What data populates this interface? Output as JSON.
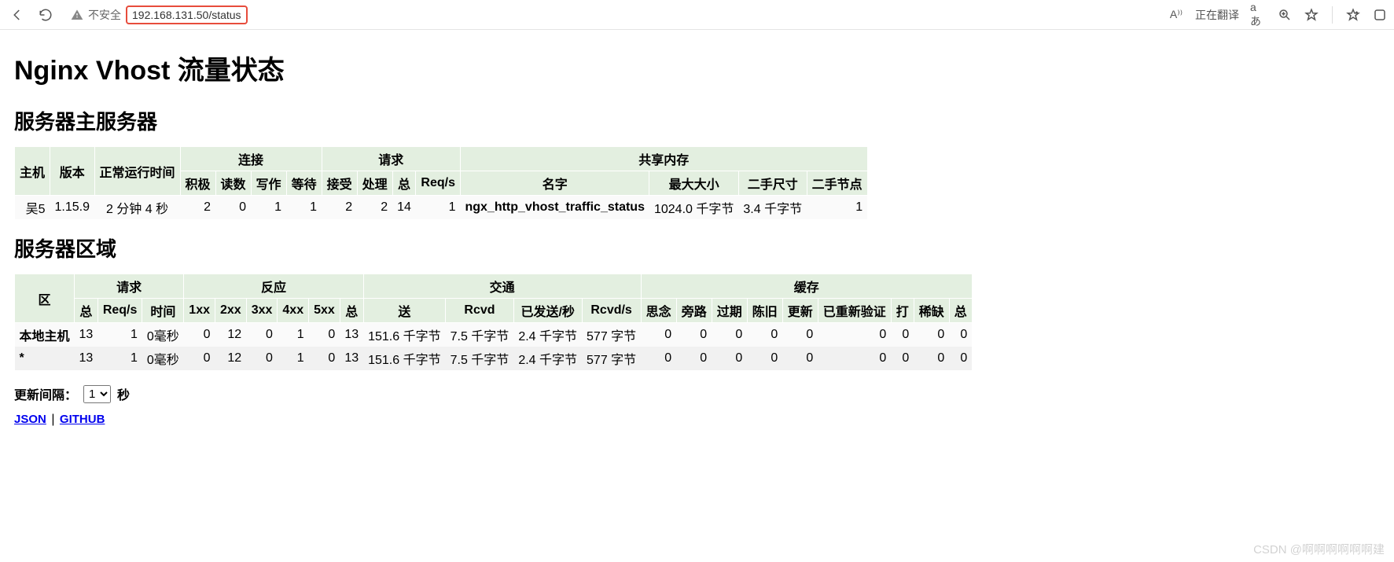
{
  "browser": {
    "security_text": "不安全",
    "url": "192.168.131.50/status",
    "translate_label": "正在翻译",
    "read_aloud": "A⁾⁾",
    "lang": "aあ"
  },
  "page": {
    "title": "Nginx Vhost 流量状态",
    "section1_title": "服务器主服务器",
    "section2_title": "服务器区域"
  },
  "table1": {
    "headers": {
      "host": "主机",
      "version": "版本",
      "uptime": "正常运行时间",
      "conn": "连接",
      "req": "请求",
      "shm": "共享内存",
      "conn_sub": [
        "积极",
        "读数",
        "写作",
        "等待"
      ],
      "req_sub": [
        "接受",
        "处理",
        "总",
        "Req/s"
      ],
      "shm_sub": [
        "名字",
        "最大大小",
        "二手尺寸",
        "二手节点"
      ]
    },
    "row": {
      "host": "吴5",
      "version": "1.15.9",
      "uptime": "2 分钟 4 秒",
      "active": "2",
      "reading": "0",
      "writing": "1",
      "waiting": "1",
      "accepted": "2",
      "handled": "2",
      "total": "14",
      "reqs": "1",
      "name": "ngx_http_vhost_traffic_status",
      "max": "1024.0 千字节",
      "used_size": "3.4 千字节",
      "used_node": "1"
    }
  },
  "table2": {
    "headers": {
      "zone": "区",
      "req": "请求",
      "resp": "反应",
      "traffic": "交通",
      "cache": "缓存",
      "req_sub": [
        "总",
        "Req/s",
        "时间"
      ],
      "resp_sub": [
        "1xx",
        "2xx",
        "3xx",
        "4xx",
        "5xx",
        "总"
      ],
      "traffic_sub": [
        "送",
        "Rcvd",
        "已发送/秒",
        "Rcvd/s"
      ],
      "cache_sub": [
        "思念",
        "旁路",
        "过期",
        "陈旧",
        "更新",
        "已重新验证",
        "打",
        "稀缺",
        "总"
      ]
    },
    "rows": [
      {
        "zone": "本地主机",
        "total": "13",
        "reqs": "1",
        "time": "0毫秒",
        "1xx": "0",
        "2xx": "12",
        "3xx": "0",
        "4xx": "1",
        "5xx": "0",
        "rtotal": "13",
        "sent": "151.6 千字节",
        "rcvd": "7.5 千字节",
        "sents": "2.4 千字节",
        "rcvds": "577 字节",
        "miss": "0",
        "bypass": "0",
        "expired": "0",
        "stale": "0",
        "updating": "0",
        "reval": "0",
        "hit": "0",
        "scarce": "0",
        "ctotal": "0"
      },
      {
        "zone": "*",
        "total": "13",
        "reqs": "1",
        "time": "0毫秒",
        "1xx": "0",
        "2xx": "12",
        "3xx": "0",
        "4xx": "1",
        "5xx": "0",
        "rtotal": "13",
        "sent": "151.6 千字节",
        "rcvd": "7.5 千字节",
        "sents": "2.4 千字节",
        "rcvds": "577 字节",
        "miss": "0",
        "bypass": "0",
        "expired": "0",
        "stale": "0",
        "updating": "0",
        "reval": "0",
        "hit": "0",
        "scarce": "0",
        "ctotal": "0"
      }
    ]
  },
  "footer": {
    "interval_label": "更新间隔：",
    "interval_value": "1",
    "interval_unit": "秒",
    "link_json": "JSON",
    "link_github": "GITHUB"
  },
  "watermark": "CSDN @啊啊啊啊啊啊建"
}
